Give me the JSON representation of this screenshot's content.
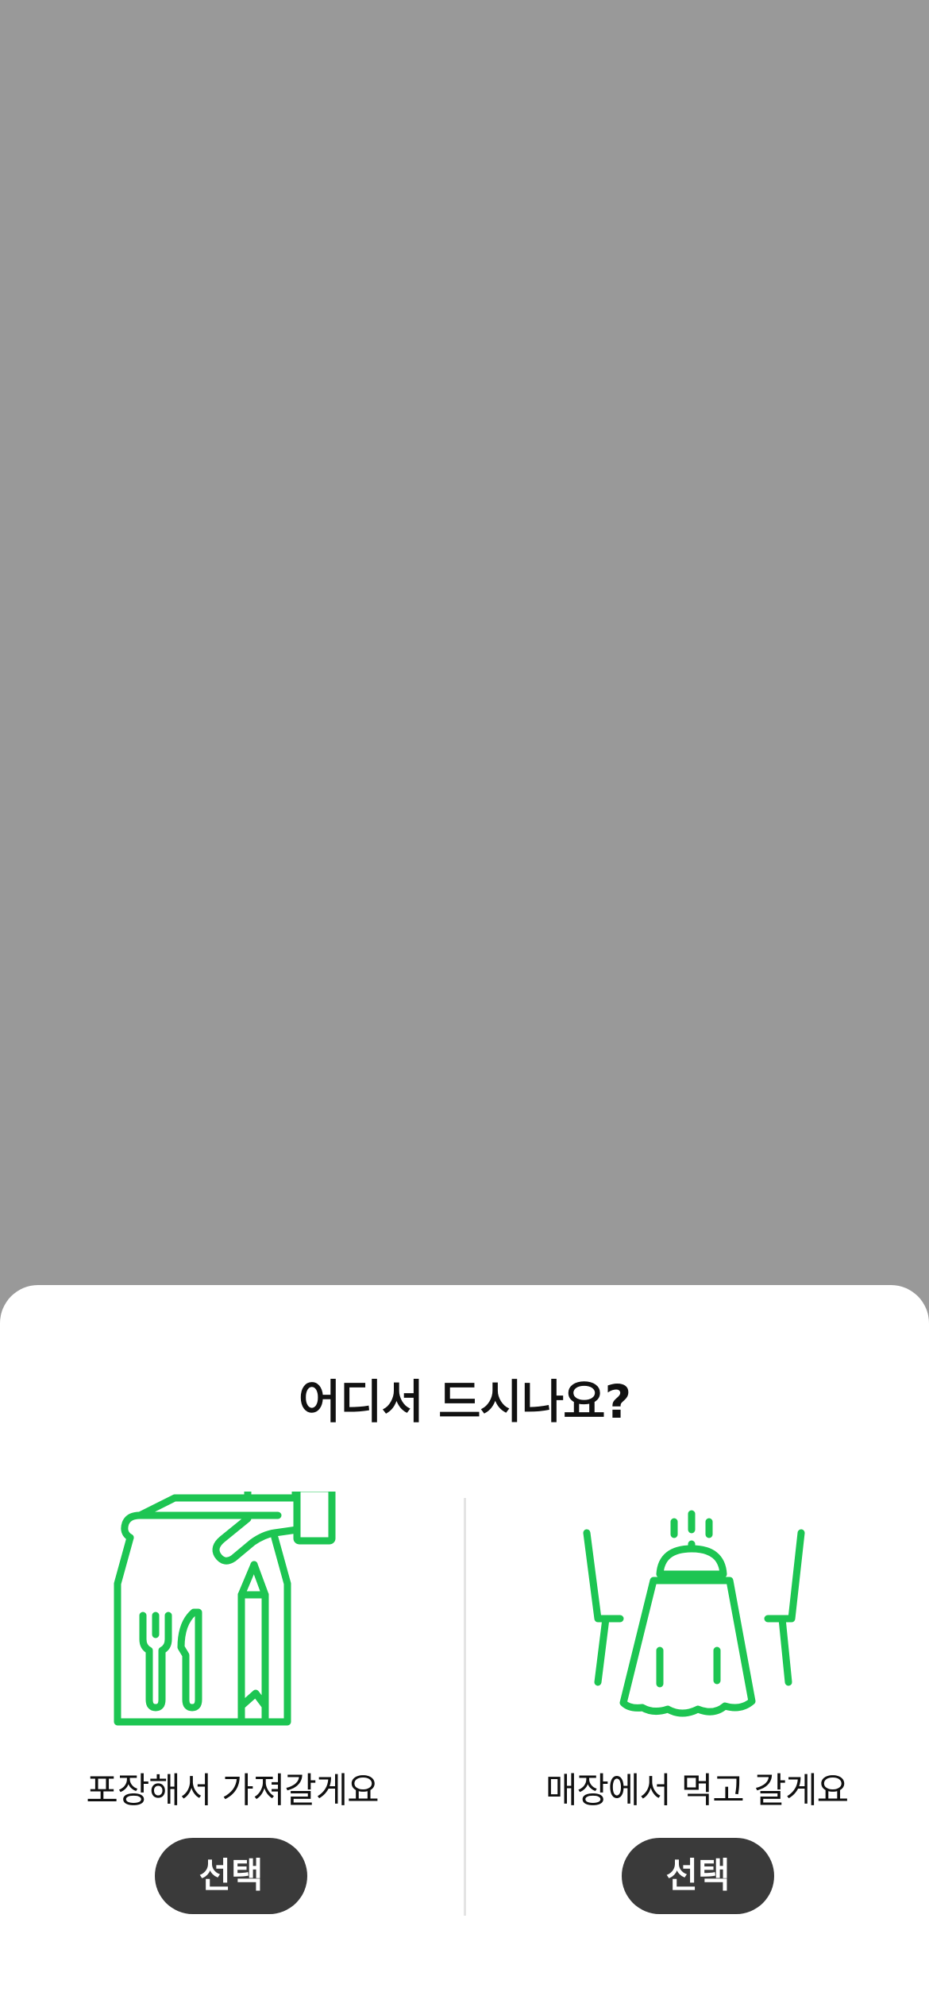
{
  "sheet": {
    "title": "어디서 드시나요?",
    "options": [
      {
        "label": "포장해서 가져갈게요",
        "button_label": "선택",
        "icon": "takeout-bag-icon"
      },
      {
        "label": "매장에서 먹고 갈게요",
        "button_label": "선택",
        "icon": "dine-in-table-icon"
      }
    ]
  },
  "colors": {
    "overlay": "#999999",
    "accent_green": "#1DC552",
    "button_dark": "#3a3a3a"
  }
}
